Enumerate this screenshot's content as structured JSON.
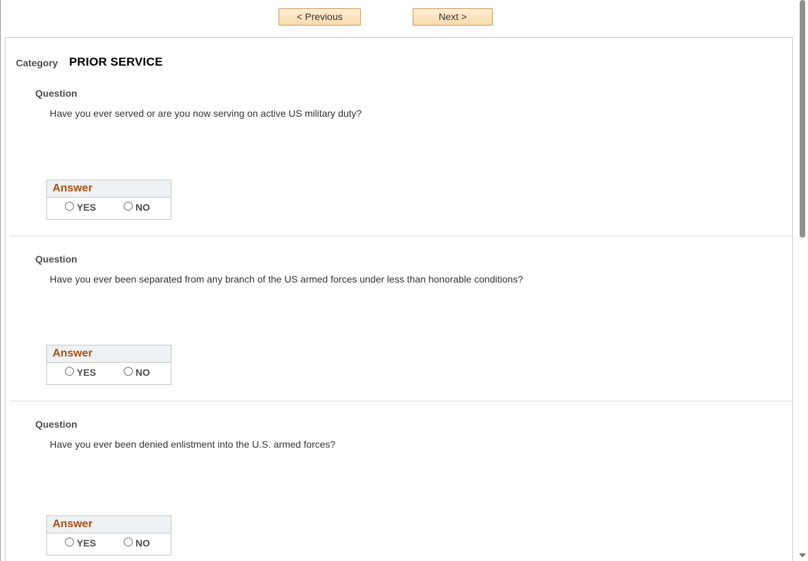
{
  "nav": {
    "previous_label": "< Previous",
    "next_label": "Next >"
  },
  "category": {
    "label": "Category",
    "value": "PRIOR SERVICE"
  },
  "questions": [
    {
      "label": "Question",
      "text": "Have you ever served or are you now serving on active US military duty?",
      "answer_header": "Answer",
      "options": [
        "YES",
        "NO"
      ]
    },
    {
      "label": "Question",
      "text": "Have you ever been separated from any branch of the US armed forces under less than honorable conditions?",
      "answer_header": "Answer",
      "options": [
        "YES",
        "NO"
      ]
    },
    {
      "label": "Question",
      "text": "Have you ever been denied enlistment into the U.S. armed forces?",
      "answer_header": "Answer",
      "options": [
        "YES",
        "NO"
      ]
    }
  ]
}
